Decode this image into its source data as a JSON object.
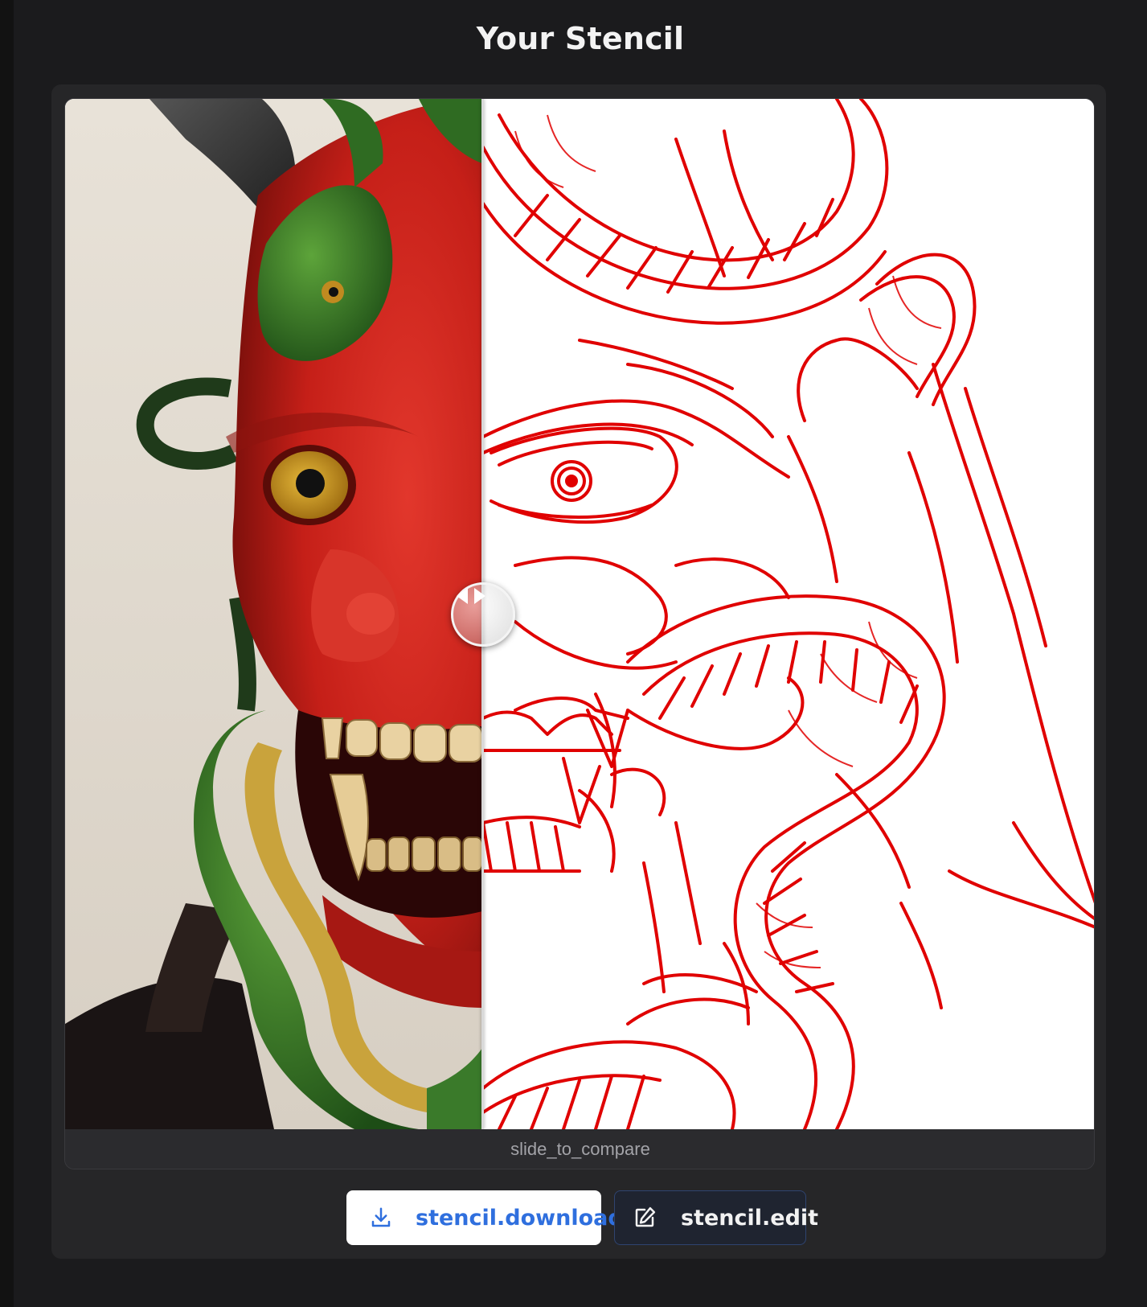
{
  "page": {
    "title": "Your Stencil"
  },
  "comparison": {
    "caption": "slide_to_compare",
    "left_image": "original-oni-mask-photo",
    "right_image": "red-line-stencil",
    "stencil_line_color": "#e00000",
    "handle_icon": "left-right-arrows-icon"
  },
  "actions": {
    "download_label": "stencil.download",
    "download_icon": "download-icon",
    "edit_label": "stencil.edit",
    "edit_icon": "edit-icon"
  }
}
